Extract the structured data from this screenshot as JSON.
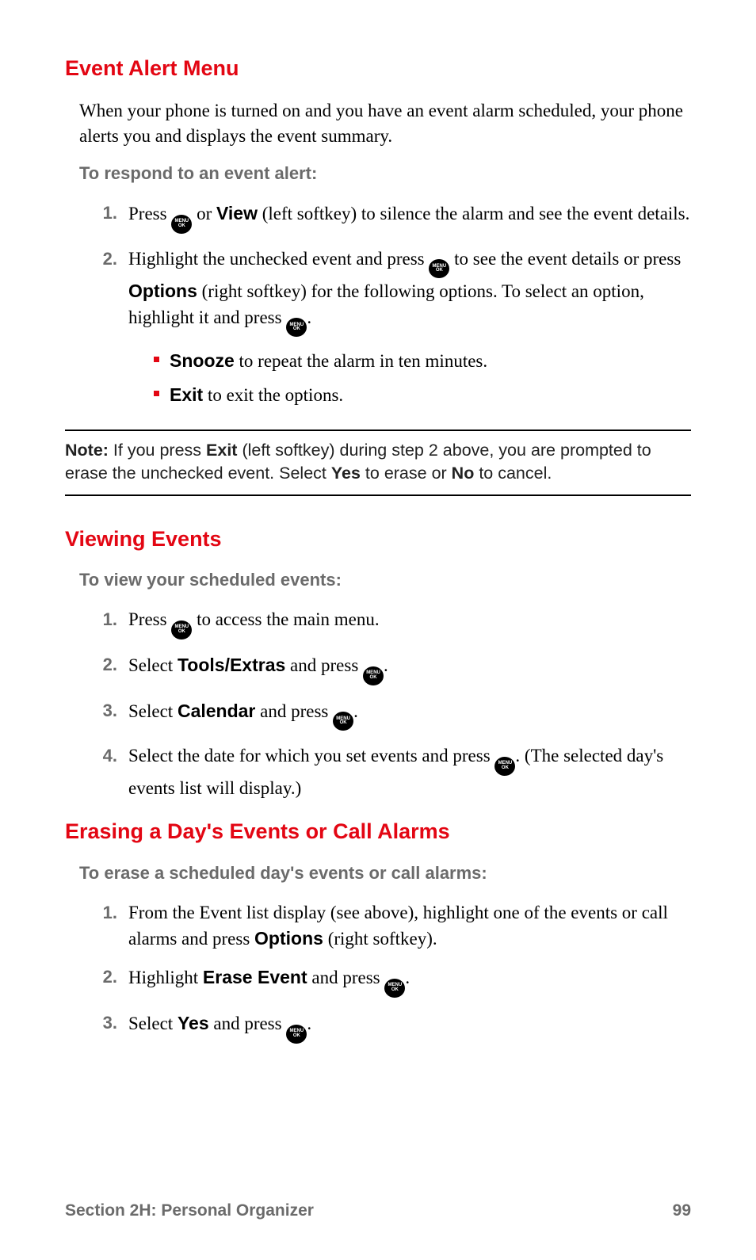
{
  "section1": {
    "heading": "Event Alert Menu",
    "intro": "When your phone is turned on and you have an event alarm scheduled, your phone alerts you and displays the event summary.",
    "sub": "To respond to an event alert:",
    "steps": {
      "s1_a": "Press ",
      "s1_b": " or ",
      "s1_view": "View",
      "s1_c": " (left softkey) to silence the alarm and see the event details.",
      "s2_a": "Highlight the unchecked event and press ",
      "s2_b": " to see the event details or press ",
      "s2_options": "Options",
      "s2_c": " (right softkey) for the following options. To select an option, highlight it and press ",
      "s2_d": "."
    },
    "bullets": {
      "b1_bold": "Snooze",
      "b1_rest": " to repeat the alarm in ten minutes.",
      "b2_bold": "Exit",
      "b2_rest": " to exit the options."
    }
  },
  "note": {
    "label": "Note: ",
    "a": "If you press ",
    "exit": "Exit",
    "b": " (left softkey) during step 2 above, you are prompted to erase the unchecked event. Select ",
    "yes": "Yes",
    "c": " to erase or ",
    "no": "No",
    "d": " to cancel."
  },
  "section2": {
    "heading": "Viewing Events",
    "sub": "To view your scheduled events:",
    "steps": {
      "s1_a": "Press ",
      "s1_b": " to access the main menu.",
      "s2_a": "Select ",
      "s2_tools": "Tools/Extras",
      "s2_b": " and press ",
      "s2_c": ".",
      "s3_a": "Select ",
      "s3_cal": "Calendar",
      "s3_b": " and press ",
      "s3_c": ".",
      "s4_a": "Select the date for which you set events and press ",
      "s4_b": ". (The selected day's events list will display.)"
    }
  },
  "section3": {
    "heading": "Erasing a Day's Events or Call Alarms",
    "sub": "To erase a scheduled day's events or call alarms:",
    "steps": {
      "s1_a": "From the Event list display (see above), highlight one of the events or call alarms and press ",
      "s1_options": "Options",
      "s1_b": " (right softkey).",
      "s2_a": "Highlight ",
      "s2_erase": "Erase Event",
      "s2_b": " and press ",
      "s2_c": ".",
      "s3_a": "Select ",
      "s3_yes": "Yes",
      "s3_b": " and press ",
      "s3_c": "."
    }
  },
  "footer": {
    "left": "Section 2H: Personal Organizer",
    "right": "99"
  },
  "icon": {
    "l1": "MENU",
    "l2": "OK"
  },
  "nums": {
    "n1": "1.",
    "n2": "2.",
    "n3": "3.",
    "n4": "4."
  }
}
